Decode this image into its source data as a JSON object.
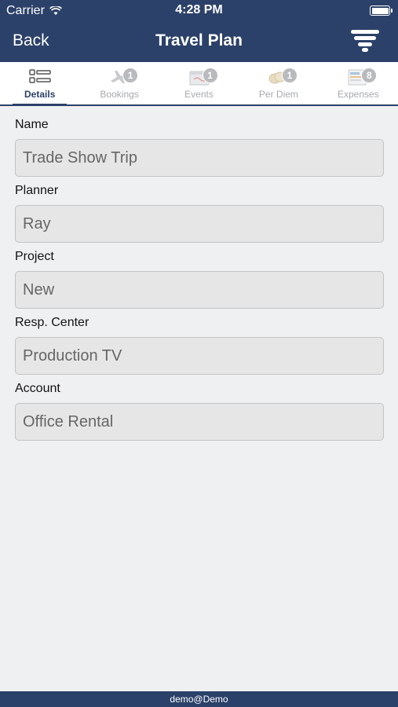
{
  "status_bar": {
    "carrier": "Carrier",
    "time": "4:28 PM"
  },
  "nav": {
    "back_label": "Back",
    "title": "Travel Plan"
  },
  "tabs": [
    {
      "label": "Details",
      "icon": "details-list-icon",
      "active": true
    },
    {
      "label": "Bookings",
      "icon": "airplane-icon",
      "badge": "1"
    },
    {
      "label": "Events",
      "icon": "calendar-icon",
      "badge": "1"
    },
    {
      "label": "Per Diem",
      "icon": "coins-icon",
      "badge": "1"
    },
    {
      "label": "Expenses",
      "icon": "receipt-icon",
      "badge": "8"
    }
  ],
  "form": {
    "name": {
      "label": "Name",
      "value": "Trade Show Trip"
    },
    "planner": {
      "label": "Planner",
      "value": "Ray"
    },
    "project": {
      "label": "Project",
      "value": "New"
    },
    "resp_center": {
      "label": "Resp. Center",
      "value": "Production TV"
    },
    "account": {
      "label": "Account",
      "value": "Office Rental"
    }
  },
  "footer": {
    "user": "demo@Demo"
  },
  "colors": {
    "brand": "#2b4169",
    "background": "#eff0f2",
    "field_bg": "#e6e6e6",
    "badge": "#b8babd"
  }
}
